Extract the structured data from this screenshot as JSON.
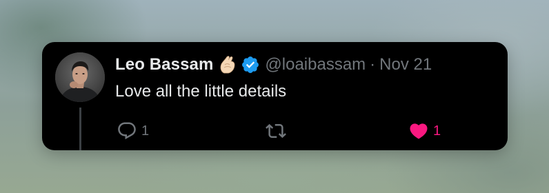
{
  "tweet": {
    "author_name": "Leo Bassam",
    "handle": "@loaibassam",
    "separator": "·",
    "date": "Nov 21",
    "text": "Love all the little details",
    "name_emoji": "pinched-fingers-emoji",
    "verified": true
  },
  "actions": {
    "reply_count": "1",
    "repost_count": "",
    "like_count": "1",
    "liked": true
  },
  "icons": {
    "reply": "reply-icon",
    "repost": "repost-icon",
    "like": "heart-icon",
    "verified": "verified-badge-icon"
  },
  "colors": {
    "card_background": "#000000",
    "primary_text": "#e7e9ea",
    "secondary_text": "#71767b",
    "verified_blue": "#1d9bf0",
    "like_pink": "#f91880"
  }
}
